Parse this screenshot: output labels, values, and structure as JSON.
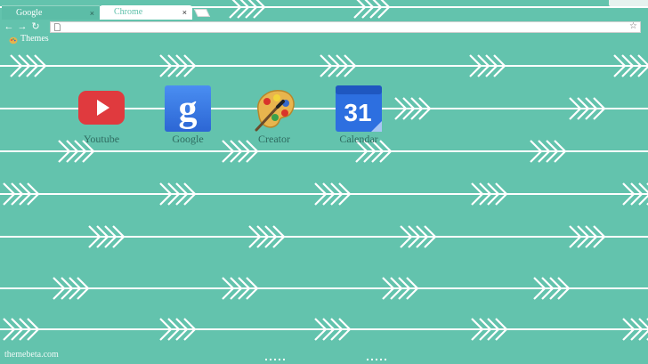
{
  "tabs": [
    {
      "label": "Google",
      "close": "×",
      "active": false
    },
    {
      "label": "Chrome",
      "close": "×",
      "active": true
    }
  ],
  "toolbar": {
    "back": "←",
    "forward": "→",
    "reload": "↻",
    "address": ""
  },
  "bookmarks": [
    {
      "label": "Themes",
      "icon": "palette-icon"
    }
  ],
  "apps": [
    {
      "label": "Youtube",
      "icon": "youtube-icon"
    },
    {
      "label": "Google",
      "icon": "google-icon"
    },
    {
      "label": "Creator",
      "icon": "palette-icon"
    },
    {
      "label": "Calendar",
      "icon": "calendar-icon",
      "day": "31"
    }
  ],
  "footer": {
    "text": "themebeta.com"
  },
  "colors": {
    "background": "#63c3ad",
    "arrow": "#ffffff",
    "label": "#2f6b60",
    "youtube_red": "#e03a3e",
    "google_blue": "#3d7be6",
    "calendar_blue": "#2d6fe0"
  }
}
